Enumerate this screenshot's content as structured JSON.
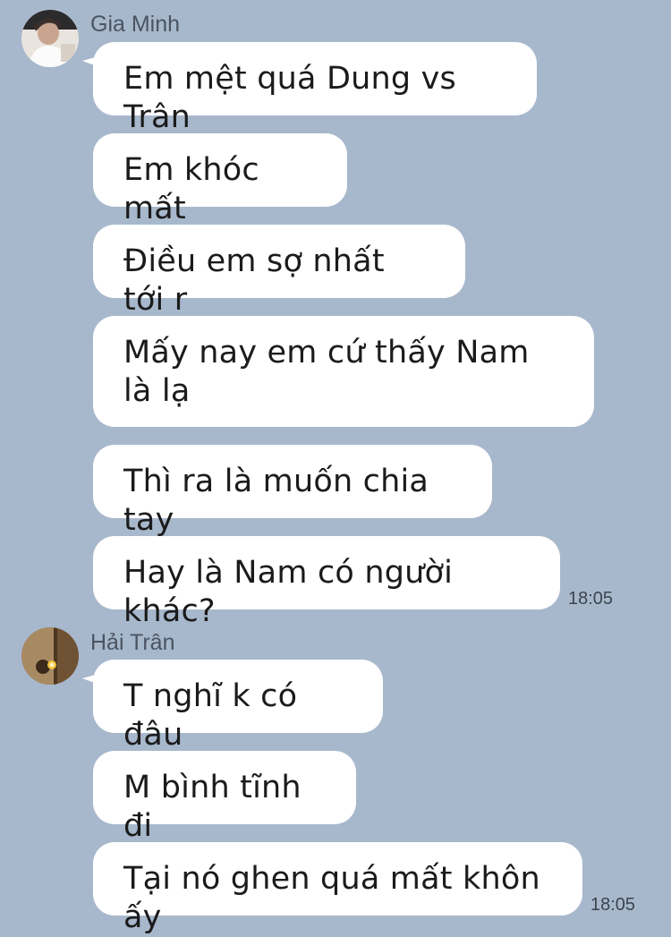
{
  "groups": [
    {
      "sender": "Gia Minh",
      "avatar_icon": "user-avatar-icon",
      "messages": [
        "Em mệt quá Dung vs Trân",
        "Em khóc mất",
        "Điều em sợ nhất tới r",
        "Mấy nay em cứ thấy Nam là lạ",
        "Thì ra là muốn chia tay",
        "Hay là Nam có người khác?"
      ],
      "time": "18:05"
    },
    {
      "sender": "Hải Trân",
      "avatar_icon": "user-avatar-icon",
      "messages": [
        "T nghĩ k có đâu",
        "M bình tĩnh đi",
        "Tại nó ghen quá mất khôn ấy"
      ],
      "time": "18:05"
    }
  ],
  "colors": {
    "background": "#a8b8cc",
    "bubble": "#ffffff",
    "text": "#1b1b1b",
    "sender": "#4a5463"
  }
}
